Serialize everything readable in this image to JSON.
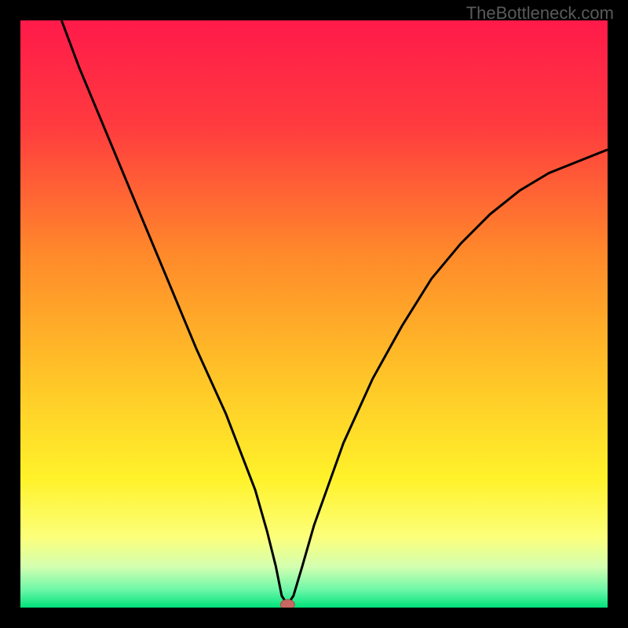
{
  "watermark": "TheBottleneck.com",
  "chart_data": {
    "type": "line",
    "title": "",
    "xlabel": "",
    "ylabel": "",
    "xlim": [
      0,
      100
    ],
    "ylim": [
      0,
      100
    ],
    "series": [
      {
        "name": "bottleneck-curve",
        "x": [
          7,
          10,
          15,
          20,
          25,
          30,
          35,
          40,
          42,
          43.5,
          44.5,
          45.5,
          46.5,
          48,
          50,
          55,
          60,
          65,
          70,
          75,
          80,
          85,
          90,
          95,
          100
        ],
        "values": [
          100,
          92,
          80,
          68,
          56,
          44,
          33,
          20,
          13,
          7,
          2,
          0.5,
          2,
          7,
          14,
          28,
          39,
          48,
          56,
          62,
          67,
          71,
          74,
          76,
          78
        ]
      }
    ],
    "marker": {
      "x": 45.5,
      "y": 0.5
    },
    "gradient_stops": [
      {
        "offset": 0,
        "color": "#ff1a4a"
      },
      {
        "offset": 18,
        "color": "#ff3b3f"
      },
      {
        "offset": 40,
        "color": "#ff8a2a"
      },
      {
        "offset": 60,
        "color": "#ffc228"
      },
      {
        "offset": 78,
        "color": "#fff22a"
      },
      {
        "offset": 88,
        "color": "#fcff7a"
      },
      {
        "offset": 93,
        "color": "#d4ffb0"
      },
      {
        "offset": 97,
        "color": "#6cf7a8"
      },
      {
        "offset": 100,
        "color": "#00e27a"
      }
    ]
  }
}
